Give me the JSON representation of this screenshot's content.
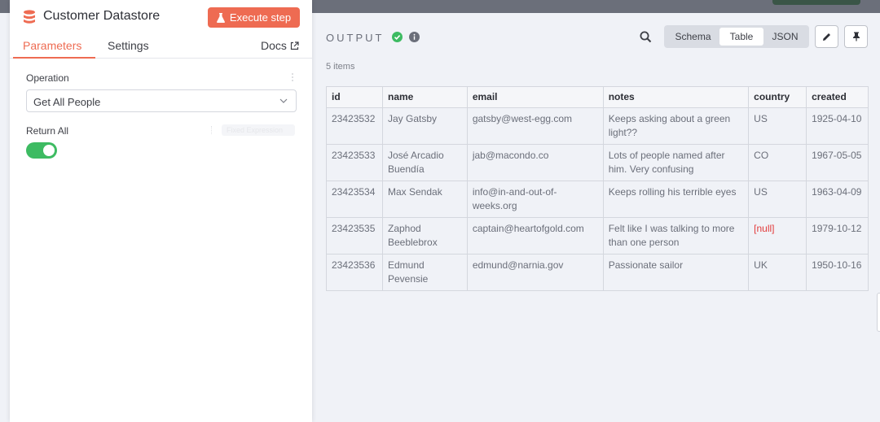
{
  "colors": {
    "accent": "#ee6b52",
    "success": "#3dbb62",
    "null_text": "#e23b3b"
  },
  "node": {
    "icon": "database-stack-icon",
    "title": "Customer Datastore",
    "execute_label": "Execute step"
  },
  "tabs": {
    "parameters": "Parameters",
    "settings": "Settings",
    "docs": "Docs"
  },
  "params": {
    "operation_label": "Operation",
    "operation_value": "Get All People",
    "return_all_label": "Return All",
    "fixed_expression_label": "Fixed Expression",
    "return_all_on": true
  },
  "output": {
    "title": "OUTPUT",
    "items_count": "5 items",
    "views": [
      "Schema",
      "Table",
      "JSON"
    ],
    "active_view": "Table"
  },
  "table": {
    "columns": [
      "id",
      "name",
      "email",
      "notes",
      "country",
      "created"
    ],
    "rows": [
      [
        "23423532",
        "Jay Gatsby",
        "gatsby@west-egg.com",
        "Keeps asking about a green light??",
        "US",
        "1925-04-10"
      ],
      [
        "23423533",
        "José Arcadio Buendía",
        "jab@macondo.co",
        "Lots of people named after him. Very confusing",
        "CO",
        "1967-05-05"
      ],
      [
        "23423534",
        "Max Sendak",
        "info@in-and-out-of-weeks.org",
        "Keeps rolling his terrible eyes",
        "US",
        "1963-04-09"
      ],
      [
        "23423535",
        "Zaphod Beeblebrox",
        "captain@heartofgold.com",
        "Felt like I was talking to more than one person",
        "[null]",
        "1979-10-12"
      ],
      [
        "23423536",
        "Edmund Pevensie",
        "edmund@narnia.gov",
        "Passionate sailor",
        "UK",
        "1950-10-16"
      ]
    ]
  }
}
